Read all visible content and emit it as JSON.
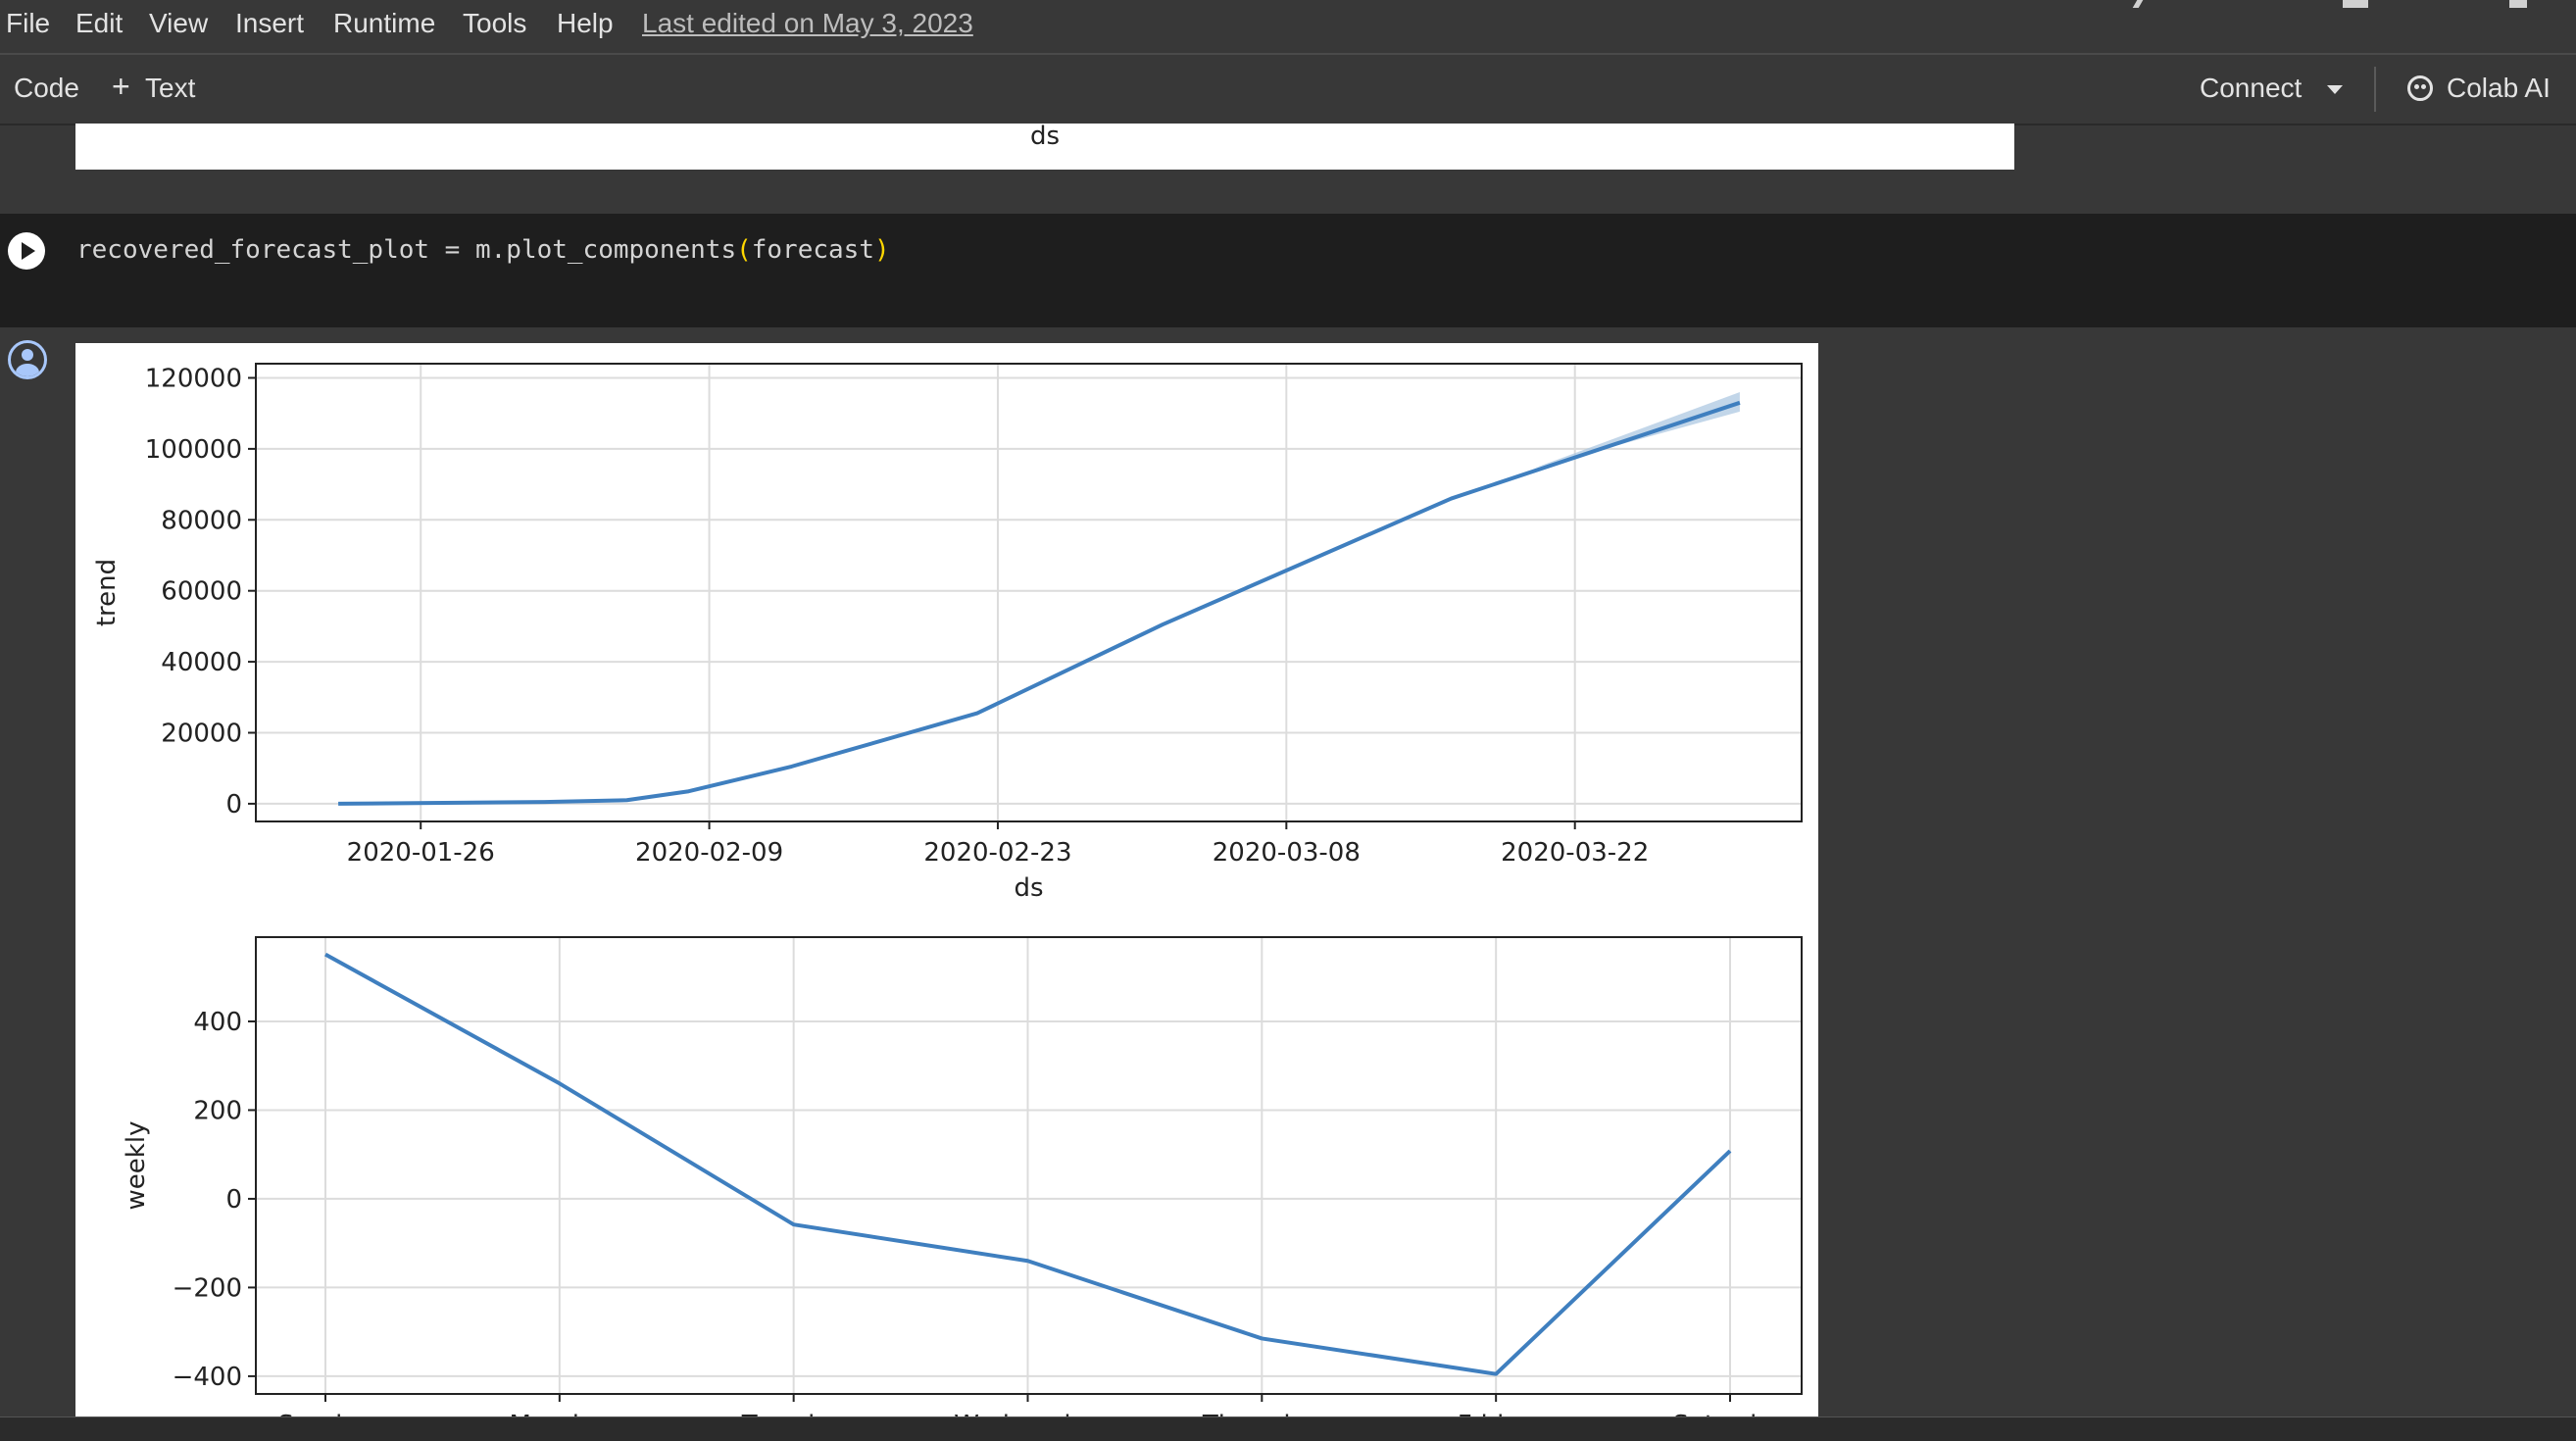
{
  "menu": {
    "items": [
      "File",
      "Edit",
      "View",
      "Insert",
      "Runtime",
      "Tools",
      "Help"
    ],
    "last_edited": "Last edited on May 3, 2023"
  },
  "toolbar": {
    "code_label": "Code",
    "text_label": "Text",
    "connect_label": "Connect",
    "colab_ai_label": "Colab AI"
  },
  "previous_output": {
    "axis_label": "ds"
  },
  "cell": {
    "code_prefix": "recovered_forecast_plot = m.plot_components",
    "code_open": "(",
    "code_arg": "forecast",
    "code_close": ")"
  },
  "colors": {
    "line": "#3f7fbf",
    "band": "#a8c4e0",
    "grid": "#dcdcdc"
  },
  "chart_data": [
    {
      "type": "line",
      "title": "",
      "xlabel": "ds",
      "ylabel": "trend",
      "x_ticks": [
        "2020-01-26",
        "2020-02-09",
        "2020-02-23",
        "2020-03-08",
        "2020-03-22"
      ],
      "y_ticks": [
        "0",
        "20000",
        "40000",
        "60000",
        "80000",
        "100000",
        "120000"
      ],
      "ylim": [
        -5000,
        124000
      ],
      "xlim": [
        "2020-01-18",
        "2020-04-02"
      ],
      "grid": true,
      "series": [
        {
          "x": [
            "2020-01-22",
            "2020-02-01",
            "2020-02-05",
            "2020-02-08",
            "2020-02-13",
            "2020-02-22",
            "2020-03-02",
            "2020-03-16",
            "2020-03-30"
          ],
          "values": [
            0,
            500,
            1000,
            3500,
            10500,
            25500,
            50500,
            86000,
            113000
          ]
        }
      ],
      "uncertainty": {
        "x": [
          "2020-03-20",
          "2020-03-30"
        ],
        "lower": [
          94500,
          110500
        ],
        "upper": [
          94500,
          116000
        ]
      }
    },
    {
      "type": "line",
      "title": "",
      "xlabel": "",
      "ylabel": "weekly",
      "categories": [
        "Sunday",
        "Monday",
        "Tuesday",
        "Wednesday",
        "Thursday",
        "Friday",
        "Saturday"
      ],
      "y_ticks": [
        "400",
        "200",
        "0",
        "−200",
        "−400"
      ],
      "ylim": [
        -440,
        590
      ],
      "grid": true,
      "series": [
        {
          "values": [
            551,
            260,
            -58,
            -140,
            -315,
            -395,
            108
          ]
        }
      ]
    }
  ]
}
